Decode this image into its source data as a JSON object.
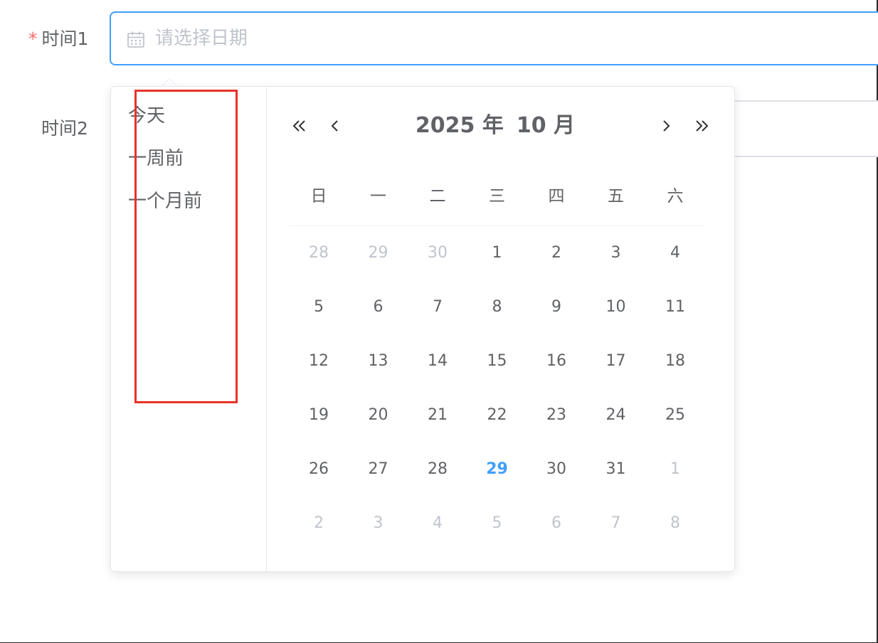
{
  "form": {
    "field1": {
      "required_mark": "*",
      "label": "时间1",
      "placeholder": "请选择日期",
      "value": ""
    },
    "field2": {
      "label": "时间2"
    }
  },
  "picker": {
    "shortcuts": [
      {
        "label": "今天"
      },
      {
        "label": "一周前"
      },
      {
        "label": "一个月前"
      }
    ],
    "header": {
      "year": "2025 年",
      "month": "10 月"
    },
    "icons": {
      "prev_year": "double-chevron-left-icon",
      "prev_month": "chevron-left-icon",
      "next_month": "chevron-right-icon",
      "next_year": "double-chevron-right-icon",
      "input": "calendar-icon"
    },
    "weekdays": [
      "日",
      "一",
      "二",
      "三",
      "四",
      "五",
      "六"
    ],
    "weeks": [
      [
        {
          "d": "28",
          "o": true
        },
        {
          "d": "29",
          "o": true
        },
        {
          "d": "30",
          "o": true
        },
        {
          "d": "1"
        },
        {
          "d": "2"
        },
        {
          "d": "3"
        },
        {
          "d": "4"
        }
      ],
      [
        {
          "d": "5"
        },
        {
          "d": "6"
        },
        {
          "d": "7"
        },
        {
          "d": "8"
        },
        {
          "d": "9"
        },
        {
          "d": "10"
        },
        {
          "d": "11"
        }
      ],
      [
        {
          "d": "12"
        },
        {
          "d": "13"
        },
        {
          "d": "14"
        },
        {
          "d": "15"
        },
        {
          "d": "16"
        },
        {
          "d": "17"
        },
        {
          "d": "18"
        }
      ],
      [
        {
          "d": "19"
        },
        {
          "d": "20"
        },
        {
          "d": "21"
        },
        {
          "d": "22"
        },
        {
          "d": "23"
        },
        {
          "d": "24"
        },
        {
          "d": "25"
        }
      ],
      [
        {
          "d": "26"
        },
        {
          "d": "27"
        },
        {
          "d": "28"
        },
        {
          "d": "29",
          "t": true
        },
        {
          "d": "30"
        },
        {
          "d": "31"
        },
        {
          "d": "1",
          "o": true
        }
      ],
      [
        {
          "d": "2",
          "o": true
        },
        {
          "d": "3",
          "o": true
        },
        {
          "d": "4",
          "o": true
        },
        {
          "d": "5",
          "o": true
        },
        {
          "d": "6",
          "o": true
        },
        {
          "d": "7",
          "o": true
        },
        {
          "d": "8",
          "o": true
        }
      ]
    ]
  },
  "colors": {
    "accent": "#409eff",
    "required": "#f56c6c",
    "text": "#606266",
    "muted": "#c0c4cc",
    "highlight_box": "#e8332a"
  }
}
